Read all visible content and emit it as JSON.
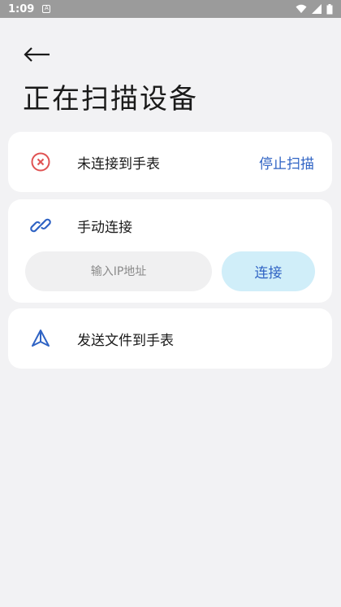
{
  "status_bar": {
    "time": "1:09",
    "notification_badge": "A"
  },
  "header": {
    "back_icon": "arrow-left-icon",
    "title": "正在扫描设备"
  },
  "scan_card": {
    "icon": "close-circle-icon",
    "icon_color": "#e05252",
    "status": "未连接到手表",
    "action": "停止扫描"
  },
  "manual_card": {
    "icon": "link-icon",
    "icon_color": "#2f63c4",
    "label": "手动连接",
    "ip_placeholder": "输入IP地址",
    "ip_value": "",
    "connect_label": "连接"
  },
  "send_card": {
    "icon": "send-triangle-icon",
    "icon_color": "#2f63c4",
    "label": "发送文件到手表"
  },
  "colors": {
    "accent": "#2f63c4",
    "connect_button_bg": "#d0eef9",
    "background": "#f2f2f4",
    "card": "#ffffff"
  }
}
